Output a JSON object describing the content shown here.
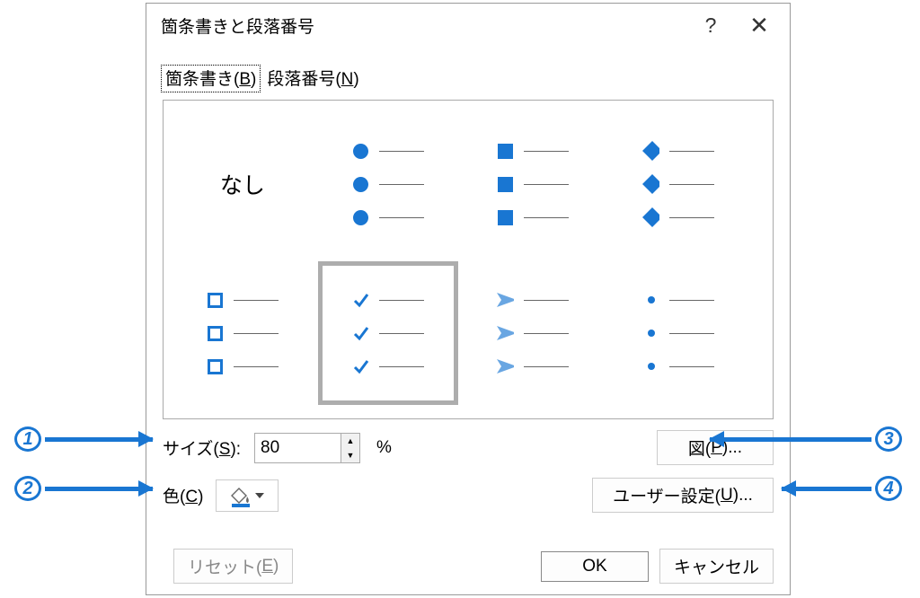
{
  "dialog": {
    "title": "箇条書きと段落番号",
    "help_symbol": "?",
    "close_symbol": "✕"
  },
  "tabs": {
    "bullets": {
      "label": "箇条書き(",
      "key": "B",
      "suffix": ")"
    },
    "numbering": {
      "label": "段落番号(",
      "key": "N",
      "suffix": ")"
    }
  },
  "preview": {
    "none_label": "なし"
  },
  "controls": {
    "size": {
      "label_pre": "サイズ(",
      "key": "S",
      "label_post": "):",
      "value": "80",
      "pct": "%"
    },
    "color": {
      "label_pre": "色(",
      "key": "C",
      "label_post": ")"
    },
    "picture": {
      "label_pre": "図(",
      "key": "P",
      "label_post": ")..."
    },
    "customize": {
      "label_pre": "ユーザー設定(",
      "key": "U",
      "label_post": ")..."
    }
  },
  "footer": {
    "reset": {
      "label_pre": "リセット(",
      "key": "E",
      "label_post": ")"
    },
    "ok": "OK",
    "cancel": "キャンセル"
  },
  "annotations": {
    "a1": "1",
    "a2": "2",
    "a3": "3",
    "a4": "4"
  }
}
